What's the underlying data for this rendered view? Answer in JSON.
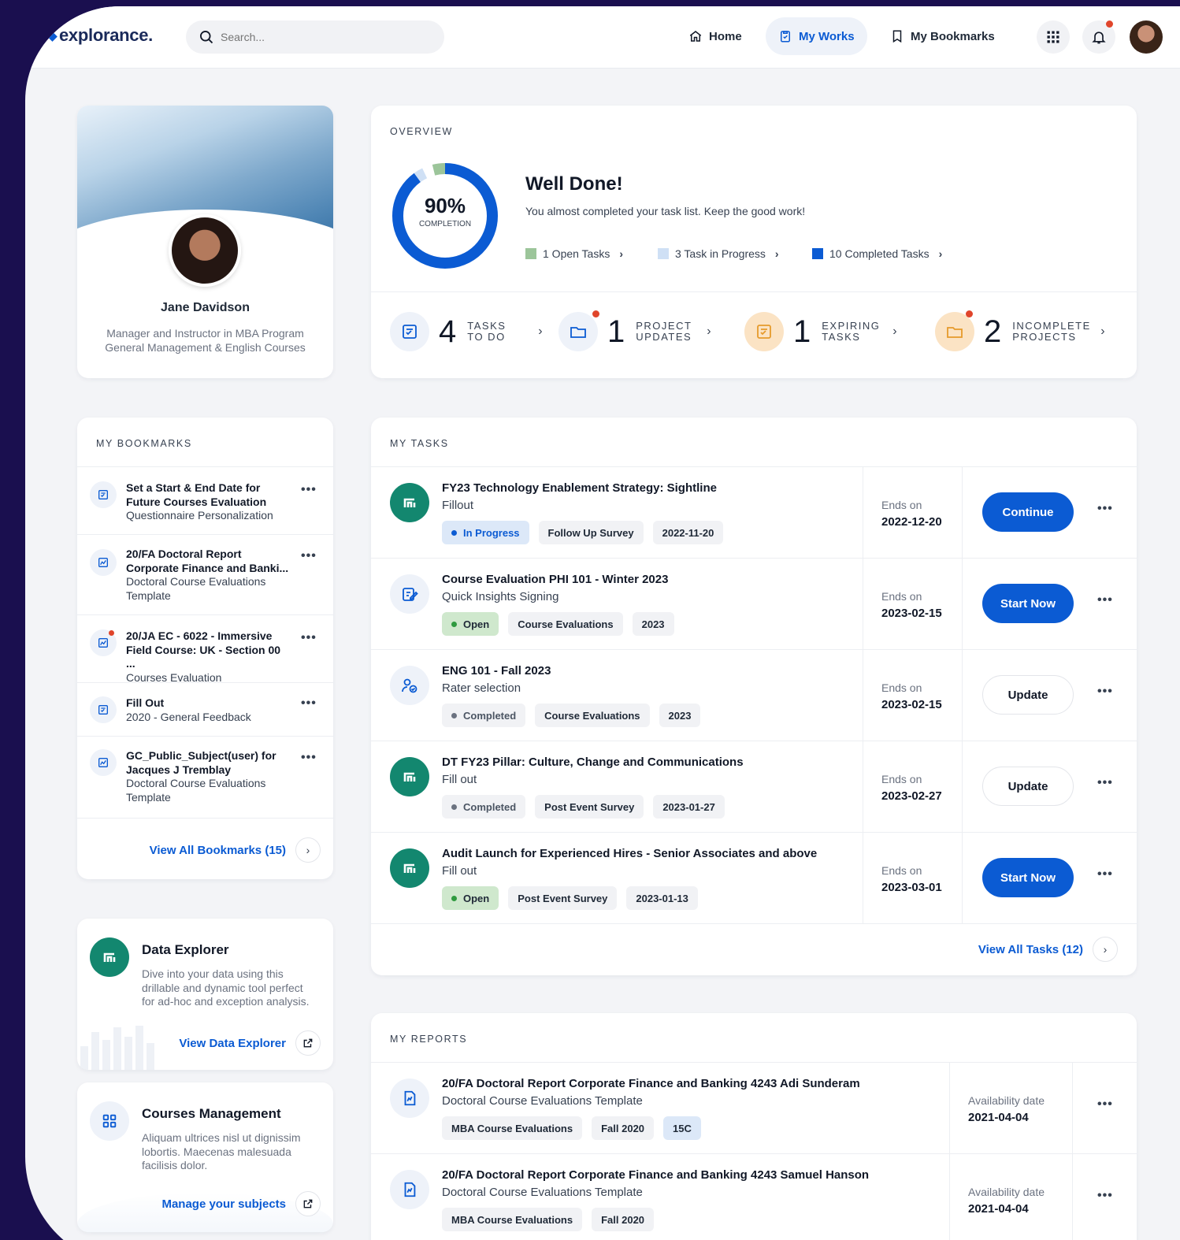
{
  "brand": {
    "name": "explorance."
  },
  "search": {
    "placeholder": "Search..."
  },
  "nav": {
    "home": "Home",
    "my_works": "My Works",
    "my_bookmarks": "My Bookmarks"
  },
  "profile": {
    "name": "Jane Davidson",
    "role_line1": "Manager and Instructor in MBA Program",
    "role_line2": "General Management & English Courses"
  },
  "overview": {
    "title": "OVERVIEW",
    "completion_pct": "90%",
    "completion_label": "COMPLETION",
    "completion_value": 0.9,
    "headline": "Well Done!",
    "subtitle": "You almost completed your task list. Keep the good work!",
    "legend": [
      {
        "label": "1 Open Tasks",
        "color": "#9cc59a"
      },
      {
        "label": "3 Task in Progress",
        "color": "#cfe0f5"
      },
      {
        "label": "10 Completed Tasks",
        "color": "#0b5bd3"
      }
    ],
    "stats": [
      {
        "num": "4",
        "l1": "TASKS",
        "l2": "TO DO"
      },
      {
        "num": "1",
        "l1": "PROJECT",
        "l2": "UPDATES"
      },
      {
        "num": "1",
        "l1": "EXPIRING",
        "l2": "TASKS"
      },
      {
        "num": "2",
        "l1": "INCOMPLETE",
        "l2": "PROJECTS"
      }
    ]
  },
  "bookmarks": {
    "title": "MY BOOKMARKS",
    "items": [
      {
        "b1": "Set a Start & End Date for",
        "b2": "Future Courses Evaluation",
        "t1": "Questionnaire Personalization",
        "t2": ""
      },
      {
        "b1": "20/FA Doctoral Report",
        "b2": "Corporate Finance and Banki...",
        "t1": "Doctoral Course Evaluations",
        "t2": "Template"
      },
      {
        "b1": "20/JA EC - 6022 - Immersive",
        "b2": "Field Course: UK - Section 00 ...",
        "t1": "Courses Evaluation",
        "t2": ""
      },
      {
        "b1": "Fill Out",
        "b2": "",
        "t1": "2020 - General Feedback",
        "t2": ""
      },
      {
        "b1": "GC_Public_Subject(user) for",
        "b2": "Jacques J Tremblay",
        "t1": "Doctoral Course Evaluations",
        "t2": "Template"
      }
    ],
    "view_all": "View All Bookmarks (15)"
  },
  "data_explorer": {
    "title": "Data Explorer",
    "desc": "Dive into your data using this drillable and dynamic tool perfect for ad-hoc and exception analysis.",
    "link": "View Data Explorer"
  },
  "courses_mgmt": {
    "title": "Courses Management",
    "desc": "Aliquam ultrices nisl ut dignissim lobortis. Maecenas malesuada facilisis dolor.",
    "link": "Manage your subjects"
  },
  "tasks": {
    "title": "MY TASKS",
    "ends_label": "Ends on",
    "items": [
      {
        "title": "FY23 Technology Enablement Strategy: Sightline",
        "sub": "Fillout",
        "status": "In Progress",
        "tag": "Follow Up Survey",
        "date": "2022-11-20",
        "ends": "2022-12-20",
        "action": "Continue"
      },
      {
        "title": "Course Evaluation PHI 101 - Winter 2023",
        "sub": "Quick Insights Signing",
        "status": "Open",
        "tag": "Course Evaluations",
        "date": "2023",
        "ends": "2023-02-15",
        "action": "Start Now"
      },
      {
        "title": "ENG 101 - Fall 2023",
        "sub": "Rater selection",
        "status": "Completed",
        "tag": "Course Evaluations",
        "date": "2023",
        "ends": "2023-02-15",
        "action": "Update"
      },
      {
        "title": "DT FY23 Pillar: Culture, Change and Communications",
        "sub": "Fill out",
        "status": "Completed",
        "tag": "Post Event Survey",
        "date": "2023-01-27",
        "ends": "2023-02-27",
        "action": "Update"
      },
      {
        "title": "Audit Launch for Experienced Hires - Senior Associates and above",
        "sub": "Fill out",
        "status": "Open",
        "tag": "Post Event Survey",
        "date": "2023-01-13",
        "ends": "2023-03-01",
        "action": "Start Now"
      }
    ],
    "view_all": "View All Tasks (12)"
  },
  "reports": {
    "title": "MY REPORTS",
    "avail_label": "Availability date",
    "items": [
      {
        "title": "20/FA Doctoral Report Corporate Finance and Banking 4243 Adi Sunderam",
        "sub": "Doctoral Course Evaluations Template",
        "c1": "MBA Course Evaluations",
        "c2": "Fall 2020",
        "c3": "15C",
        "date": "2021-04-04"
      },
      {
        "title": "20/FA Doctoral Report Corporate Finance and Banking 4243 Samuel Hanson",
        "sub": "Doctoral Course Evaluations Template",
        "c1": "MBA Course Evaluations",
        "c2": "Fall 2020",
        "c3": "",
        "date": "2021-04-04"
      }
    ]
  },
  "colors": {
    "accent": "#0b5bd3",
    "teal": "#13876f",
    "open": "#cfe8cd",
    "progress": "#dce8f8",
    "orange": "#fbe3c4"
  }
}
